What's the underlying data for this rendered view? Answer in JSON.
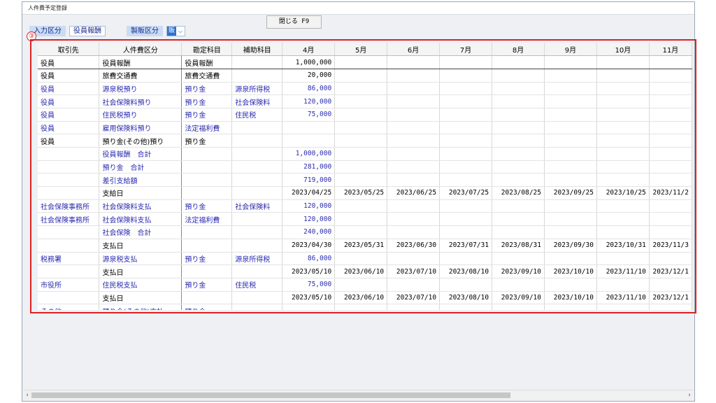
{
  "window": {
    "title": "人件費予定登録"
  },
  "toolbar": {
    "close_label": "閉じる F9"
  },
  "filters": {
    "input_label": "入力区分",
    "input_value": "役員報酬",
    "dept_label": "製販区分",
    "dept_value": "販"
  },
  "marker": "③",
  "columns": [
    "取引先",
    "人件費区分",
    "勘定科目",
    "補助科目",
    "4月",
    "5月",
    "6月",
    "7月",
    "8月",
    "9月",
    "10月",
    "11月"
  ],
  "rows": [
    {
      "style": "first",
      "cells": [
        "役員",
        "役員報酬",
        "役員報酬",
        "",
        "1,000,000",
        "",
        "",
        "",
        "",
        "",
        "",
        ""
      ]
    },
    {
      "style": "black",
      "cells": [
        "役員",
        "旅費交通費",
        "旅費交通費",
        "",
        "20,000",
        "",
        "",
        "",
        "",
        "",
        "",
        ""
      ]
    },
    {
      "style": "blue",
      "cells": [
        "役員",
        "源泉税預り",
        "預り金",
        "源泉所得税",
        "86,000",
        "",
        "",
        "",
        "",
        "",
        "",
        ""
      ]
    },
    {
      "style": "blue",
      "cells": [
        "役員",
        "社会保険料預り",
        "預り金",
        "社会保険料",
        "120,000",
        "",
        "",
        "",
        "",
        "",
        "",
        ""
      ]
    },
    {
      "style": "blue",
      "cells": [
        "役員",
        "住民税預り",
        "預り金",
        "住民税",
        "75,000",
        "",
        "",
        "",
        "",
        "",
        "",
        ""
      ]
    },
    {
      "style": "blue",
      "cells": [
        "役員",
        "雇用保険料預り",
        "法定福利費",
        "",
        "",
        "",
        "",
        "",
        "",
        "",
        "",
        ""
      ]
    },
    {
      "style": "black",
      "cells": [
        "役員",
        "預り金(その他)預り",
        "預り金",
        "",
        "",
        "",
        "",
        "",
        "",
        "",
        "",
        ""
      ]
    },
    {
      "style": "blue",
      "cells": [
        "",
        "役員報酬　合計",
        "",
        "",
        "1,000,000",
        "",
        "",
        "",
        "",
        "",
        "",
        ""
      ]
    },
    {
      "style": "blue",
      "cells": [
        "",
        "預り金　合計",
        "",
        "",
        "281,000",
        "",
        "",
        "",
        "",
        "",
        "",
        ""
      ]
    },
    {
      "style": "blue",
      "cells": [
        "",
        "差引支給額",
        "",
        "",
        "719,000",
        "",
        "",
        "",
        "",
        "",
        "",
        ""
      ]
    },
    {
      "style": "date",
      "cells": [
        "",
        "支給日",
        "",
        "",
        "2023/04/25",
        "2023/05/25",
        "2023/06/25",
        "2023/07/25",
        "2023/08/25",
        "2023/09/25",
        "2023/10/25",
        "2023/11/2"
      ]
    },
    {
      "style": "blue",
      "cells": [
        "社会保険事務所",
        "社会保険料支払",
        "預り金",
        "社会保険料",
        "120,000",
        "",
        "",
        "",
        "",
        "",
        "",
        ""
      ]
    },
    {
      "style": "blue",
      "cells": [
        "社会保険事務所",
        "社会保険料支払",
        "法定福利費",
        "",
        "120,000",
        "",
        "",
        "",
        "",
        "",
        "",
        ""
      ]
    },
    {
      "style": "blue",
      "cells": [
        "",
        "社会保険　合計",
        "",
        "",
        "240,000",
        "",
        "",
        "",
        "",
        "",
        "",
        ""
      ]
    },
    {
      "style": "date",
      "cells": [
        "",
        "支払日",
        "",
        "",
        "2023/04/30",
        "2023/05/31",
        "2023/06/30",
        "2023/07/31",
        "2023/08/31",
        "2023/09/30",
        "2023/10/31",
        "2023/11/3"
      ]
    },
    {
      "style": "blue",
      "cells": [
        "税務署",
        "源泉税支払",
        "預り金",
        "源泉所得税",
        "86,000",
        "",
        "",
        "",
        "",
        "",
        "",
        ""
      ]
    },
    {
      "style": "date",
      "cells": [
        "",
        "支払日",
        "",
        "",
        "2023/05/10",
        "2023/06/10",
        "2023/07/10",
        "2023/08/10",
        "2023/09/10",
        "2023/10/10",
        "2023/11/10",
        "2023/12/1"
      ]
    },
    {
      "style": "blue",
      "cells": [
        "市役所",
        "住民税支払",
        "預り金",
        "住民税",
        "75,000",
        "",
        "",
        "",
        "",
        "",
        "",
        ""
      ]
    },
    {
      "style": "date",
      "cells": [
        "",
        "支払日",
        "",
        "",
        "2023/05/10",
        "2023/06/10",
        "2023/07/10",
        "2023/08/10",
        "2023/09/10",
        "2023/10/10",
        "2023/11/10",
        "2023/12/1"
      ]
    },
    {
      "style": "blue",
      "cells": [
        "その他",
        "預り金(その他)支払",
        "預り金",
        "",
        "",
        "",
        "",
        "",
        "",
        "",
        "",
        ""
      ]
    }
  ],
  "scrollbar": {
    "left_arrow": "‹",
    "right_arrow": "›"
  }
}
